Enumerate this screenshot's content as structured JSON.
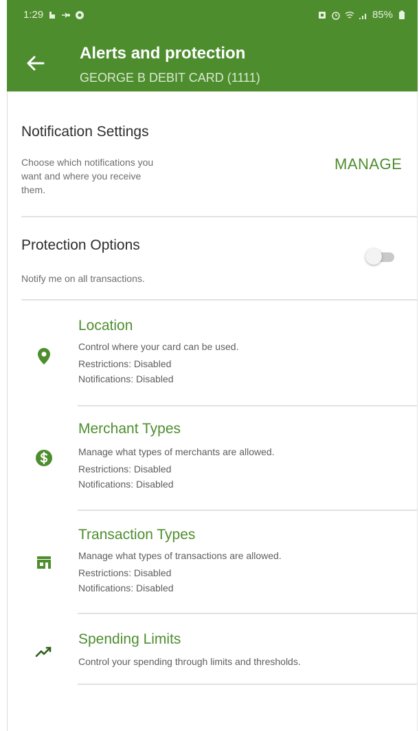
{
  "status_bar": {
    "time": "1:29",
    "battery": "85%"
  },
  "header": {
    "title": "Alerts and protection",
    "subtitle": "GEORGE B DEBIT CARD (1111)"
  },
  "notification_settings": {
    "title": "Notification Settings",
    "description_lines": [
      "Choose which notifications you",
      "want and where you receive",
      "them."
    ],
    "manage_label": "MANAGE"
  },
  "protection_options": {
    "title": "Protection Options",
    "description": "Notify me on all transactions.",
    "toggle_on": false
  },
  "items": [
    {
      "icon": "location-pin-icon",
      "name": "Location",
      "description": "Control where your card can be used.",
      "restrictions": "Restrictions: Disabled",
      "notifications": "Notifications: Disabled"
    },
    {
      "icon": "dollar-circle-icon",
      "name": "Merchant Types",
      "description": "Manage what types of merchants are allowed.",
      "restrictions": "Restrictions: Disabled",
      "notifications": "Notifications: Disabled"
    },
    {
      "icon": "storefront-icon",
      "name": "Transaction Types",
      "description": "Manage what types of transactions are allowed.",
      "restrictions": "Restrictions: Disabled",
      "notifications": "Notifications: Disabled"
    },
    {
      "icon": "trending-up-icon",
      "name": "Spending Limits",
      "description": "Control your spending through limits and thresholds."
    }
  ],
  "colors": {
    "brand_green": "#4e8d2e",
    "text": "#2d2d2d",
    "muted": "#6d6d6d",
    "divider": "#e2e2e2"
  }
}
